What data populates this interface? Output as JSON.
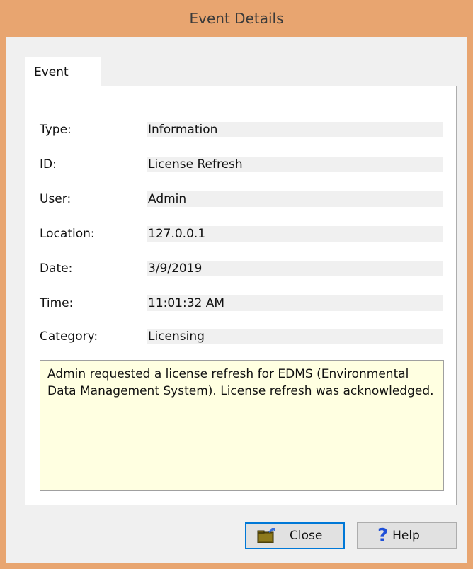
{
  "window": {
    "title": "Event Details"
  },
  "tabs": [
    {
      "label": "Event"
    }
  ],
  "fields": [
    {
      "label": "Type:",
      "value": "Information"
    },
    {
      "label": "ID:",
      "value": "License Refresh"
    },
    {
      "label": "User:",
      "value": "Admin"
    },
    {
      "label": "Location:",
      "value": "127.0.0.1"
    },
    {
      "label": "Date:",
      "value": "3/9/2019"
    },
    {
      "label": "Time:",
      "value": "11:01:32 AM"
    },
    {
      "label": "Category:",
      "value": "Licensing"
    }
  ],
  "description": "Admin requested a license refresh for EDMS (Environmental Data Management System). License refresh was acknowledged.",
  "buttons": {
    "close": {
      "label": "Close",
      "icon": "folder-close-icon"
    },
    "help": {
      "label": "Help",
      "icon": "question-mark-icon"
    }
  },
  "colors": {
    "title_bar": "#e8a570",
    "description_bg": "#ffffe1",
    "focus": "#0078d7",
    "help_icon": "#1e4fd8"
  }
}
